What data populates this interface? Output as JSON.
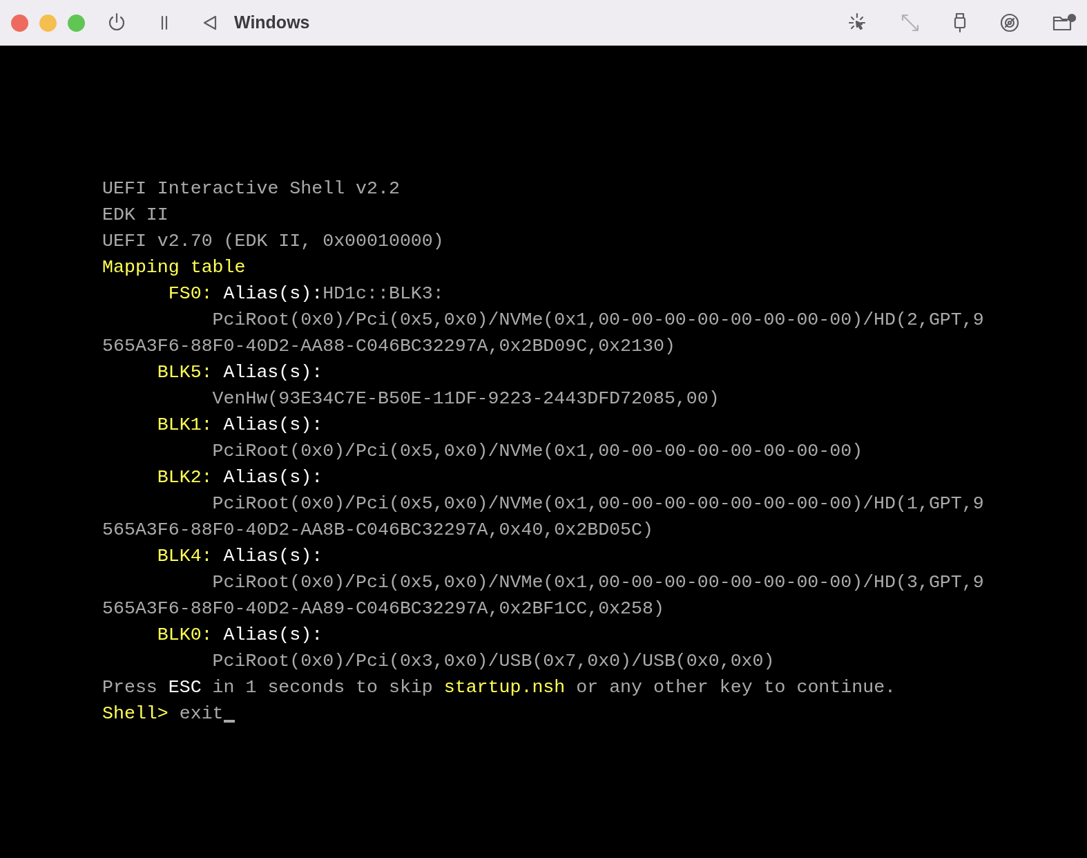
{
  "window": {
    "title": "Windows"
  },
  "toolbar": {
    "right_buttons": [
      {
        "disabled": false
      },
      {
        "disabled": true
      },
      {
        "disabled": false
      },
      {
        "disabled": false
      },
      {
        "disabled": false
      }
    ]
  },
  "terminal": {
    "lines": [
      {
        "kind": "text",
        "segments": [
          {
            "text": "UEFI Interactive Shell v2.2",
            "color": "#aaaaaa"
          }
        ]
      },
      {
        "kind": "text",
        "segments": [
          {
            "text": "EDK II",
            "color": "#aaaaaa"
          }
        ]
      },
      {
        "kind": "text",
        "segments": [
          {
            "text": "UEFI v2.70 (EDK II, 0x00010000)",
            "color": "#aaaaaa"
          }
        ]
      },
      {
        "kind": "text",
        "segments": [
          {
            "text": "Mapping table",
            "color": "#ffff55"
          }
        ]
      },
      {
        "kind": "entry",
        "label": "FS0:",
        "segments": [
          {
            "text": "Alias(s):",
            "color": "#ffffff"
          },
          {
            "text": "HD1c::BLK3:",
            "color": "#aaaaaa"
          }
        ]
      },
      {
        "kind": "path",
        "segments": [
          {
            "text": "PciRoot(0x0)/Pci(0x5,0x0)/NVMe(0x1,00-00-00-00-00-00-00-00)/HD(2,GPT,9",
            "color": "#aaaaaa"
          }
        ]
      },
      {
        "kind": "text",
        "segments": [
          {
            "text": "565A3F6-88F0-40D2-AA88-C046BC32297A,0x2BD09C,0x2130)",
            "color": "#aaaaaa"
          }
        ]
      },
      {
        "kind": "entry",
        "label": "BLK5:",
        "segments": [
          {
            "text": "Alias(s):",
            "color": "#ffffff"
          }
        ]
      },
      {
        "kind": "path",
        "segments": [
          {
            "text": "VenHw(93E34C7E-B50E-11DF-9223-2443DFD72085,00)",
            "color": "#aaaaaa"
          }
        ]
      },
      {
        "kind": "entry",
        "label": "BLK1:",
        "segments": [
          {
            "text": "Alias(s):",
            "color": "#ffffff"
          }
        ]
      },
      {
        "kind": "path",
        "segments": [
          {
            "text": "PciRoot(0x0)/Pci(0x5,0x0)/NVMe(0x1,00-00-00-00-00-00-00-00)",
            "color": "#aaaaaa"
          }
        ]
      },
      {
        "kind": "entry",
        "label": "BLK2:",
        "segments": [
          {
            "text": "Alias(s):",
            "color": "#ffffff"
          }
        ]
      },
      {
        "kind": "path",
        "segments": [
          {
            "text": "PciRoot(0x0)/Pci(0x5,0x0)/NVMe(0x1,00-00-00-00-00-00-00-00)/HD(1,GPT,9",
            "color": "#aaaaaa"
          }
        ]
      },
      {
        "kind": "text",
        "segments": [
          {
            "text": "565A3F6-88F0-40D2-AA8B-C046BC32297A,0x40,0x2BD05C)",
            "color": "#aaaaaa"
          }
        ]
      },
      {
        "kind": "entry",
        "label": "BLK4:",
        "segments": [
          {
            "text": "Alias(s):",
            "color": "#ffffff"
          }
        ]
      },
      {
        "kind": "path",
        "segments": [
          {
            "text": "PciRoot(0x0)/Pci(0x5,0x0)/NVMe(0x1,00-00-00-00-00-00-00-00)/HD(3,GPT,9",
            "color": "#aaaaaa"
          }
        ]
      },
      {
        "kind": "text",
        "segments": [
          {
            "text": "565A3F6-88F0-40D2-AA89-C046BC32297A,0x2BF1CC,0x258)",
            "color": "#aaaaaa"
          }
        ]
      },
      {
        "kind": "entry",
        "label": "BLK0:",
        "segments": [
          {
            "text": "Alias(s):",
            "color": "#ffffff"
          }
        ]
      },
      {
        "kind": "path",
        "segments": [
          {
            "text": "PciRoot(0x0)/Pci(0x3,0x0)/USB(0x7,0x0)/USB(0x0,0x0)",
            "color": "#aaaaaa"
          }
        ]
      },
      {
        "kind": "text",
        "segments": [
          {
            "text": "Press",
            "color": "#aaaaaa"
          },
          {
            "text": "ESC",
            "color": "#ffffff"
          },
          {
            "text": "in 1 seconds to skip",
            "color": "#aaaaaa"
          },
          {
            "text": "startup.nsh",
            "color": "#ffff55"
          },
          {
            "text": "or any other key to continue.",
            "color": "#aaaaaa"
          }
        ]
      },
      {
        "kind": "prompt",
        "segments": [
          {
            "text": "Shell>",
            "color": "#ffff55"
          },
          {
            "text": "exit",
            "color": "#aaaaaa"
          }
        ]
      }
    ]
  }
}
